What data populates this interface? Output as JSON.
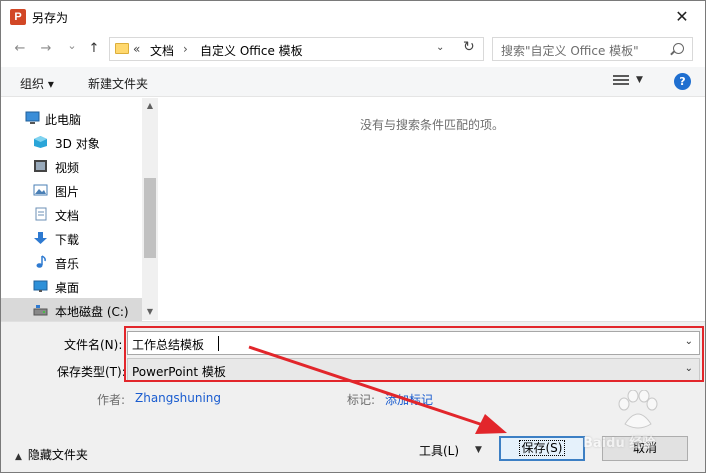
{
  "window": {
    "app_icon_letter": "P",
    "title": "另存为",
    "close_glyph": "✕"
  },
  "navbar": {
    "back_glyph": "←",
    "forward_glyph": "→",
    "dropdown_glyph": "⌄",
    "up_glyph": "↑",
    "breadcrumb_prefix": "«",
    "breadcrumb": [
      "文档",
      "自定义 Office 模板"
    ],
    "breadcrumb_sep": "›",
    "search_placeholder": "搜索\"自定义 Office 模板\""
  },
  "toolbar": {
    "organize_label": "组织 ▾",
    "new_folder_label": "新建文件夹",
    "help_glyph": "?"
  },
  "navpane": {
    "items": [
      {
        "label": "此电脑",
        "icon": "pc-icon",
        "color": "#3b8ed8"
      },
      {
        "label": "3D 对象",
        "icon": "cube-3d-icon",
        "color": "#2aa5d8"
      },
      {
        "label": "视频",
        "icon": "video-icon",
        "color": "#444444"
      },
      {
        "label": "图片",
        "icon": "pictures-icon",
        "color": "#4a7fb5"
      },
      {
        "label": "文档",
        "icon": "documents-icon",
        "color": "#6b8fb5"
      },
      {
        "label": "下载",
        "icon": "download-icon",
        "color": "#2e7ad1"
      },
      {
        "label": "音乐",
        "icon": "music-icon",
        "color": "#2e7ad1"
      },
      {
        "label": "桌面",
        "icon": "desktop-icon",
        "color": "#2e90d8"
      },
      {
        "label": "本地磁盘 (C:)",
        "icon": "disk-icon",
        "color": "#666666"
      }
    ],
    "selected_index": 8
  },
  "content": {
    "empty_message": "没有与搜索条件匹配的项。"
  },
  "form": {
    "filename_label": "文件名(N):",
    "filename_value": "工作总结模板",
    "filetype_label": "保存类型(T):",
    "filetype_value": "PowerPoint 模板",
    "author_label": "作者:",
    "author_value": "Zhangshuning",
    "tags_label": "标记:",
    "tags_value": "添加标记"
  },
  "footer": {
    "hide_folders_label": "隐藏文件夹",
    "tools_label": "工具(L)",
    "save_label": "保存(S)",
    "cancel_label": "取消"
  },
  "annotation": {
    "highlight_color": "#e2262b"
  },
  "watermark": {
    "text": "Baidu 经验"
  }
}
